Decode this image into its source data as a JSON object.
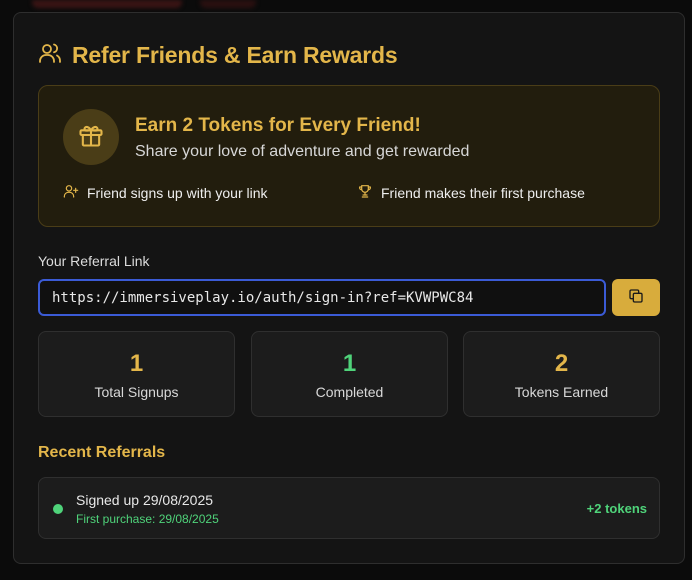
{
  "header": {
    "title": "Refer Friends & Earn Rewards",
    "icon": "users-icon"
  },
  "promo": {
    "title": "Earn 2 Tokens for Every Friend!",
    "subtitle": "Share your love of adventure and get rewarded",
    "icon": "gift-icon",
    "steps": [
      {
        "icon": "user-plus-icon",
        "label": "Friend signs up with your link"
      },
      {
        "icon": "trophy-icon",
        "label": "Friend makes their first purchase"
      }
    ]
  },
  "referral": {
    "label": "Your Referral Link",
    "link": "https://immersiveplay.io/auth/sign-in?ref=KVWPWC84",
    "copy_icon": "copy-icon"
  },
  "stats": [
    {
      "value": "1",
      "label": "Total Signups"
    },
    {
      "value": "1",
      "label": "Completed"
    },
    {
      "value": "2",
      "label": "Tokens Earned"
    }
  ],
  "recent": {
    "title": "Recent Referrals",
    "items": [
      {
        "status": "Signed up 29/08/2025",
        "detail": "First purchase: 29/08/2025",
        "reward": "+2 tokens"
      }
    ]
  },
  "colors": {
    "accent": "#e3b64a",
    "success": "#4fd37a",
    "focus": "#3b5bd6"
  }
}
